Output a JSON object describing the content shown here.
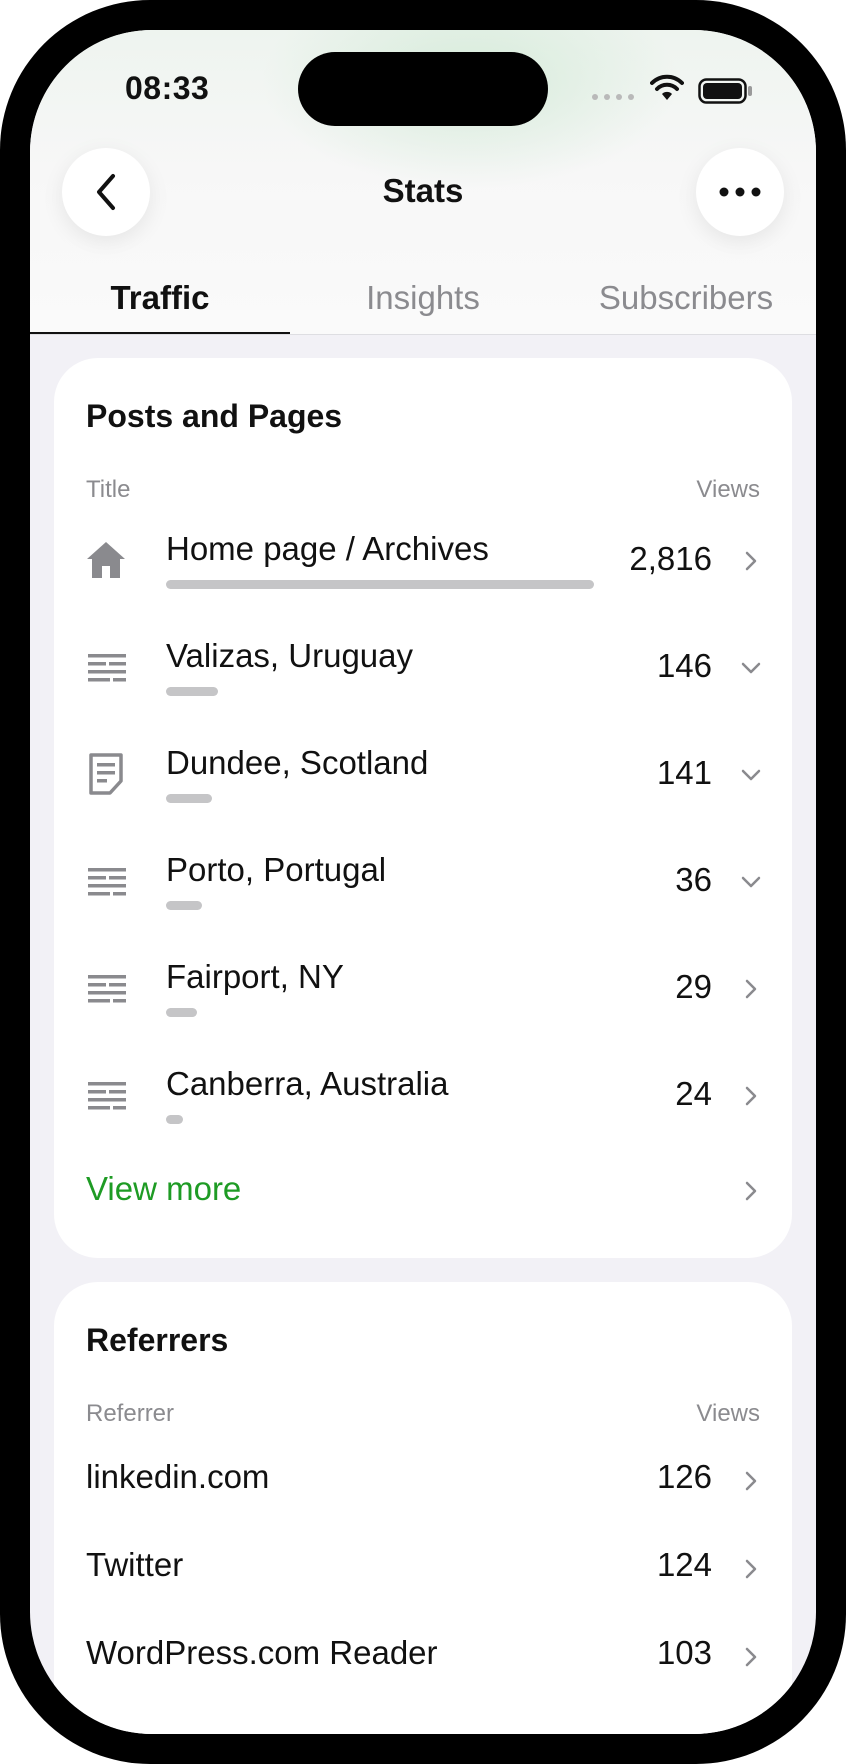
{
  "status_bar": {
    "time": "08:33"
  },
  "nav": {
    "title": "Stats",
    "back_icon": "chevron-left-icon",
    "more_icon": "ellipsis-icon"
  },
  "tabs": [
    {
      "label": "Traffic",
      "active": true
    },
    {
      "label": "Insights",
      "active": false
    },
    {
      "label": "Subscribers",
      "active": false
    }
  ],
  "posts_card": {
    "title": "Posts and Pages",
    "col_title": "Title",
    "col_views": "Views",
    "rows": [
      {
        "icon": "home-icon",
        "title": "Home page / Archives",
        "views": "2,816",
        "chevron": "chevron-right-icon",
        "bar_fraction": 1.0
      },
      {
        "icon": "text-lines-icon",
        "title": "Valizas, Uruguay",
        "views": "146",
        "chevron": "chevron-down-icon",
        "bar_fraction": 0.12
      },
      {
        "icon": "page-icon",
        "title": "Dundee, Scotland",
        "views": "141",
        "chevron": "chevron-down-icon",
        "bar_fraction": 0.105
      },
      {
        "icon": "text-lines-icon",
        "title": "Porto, Portugal",
        "views": "36",
        "chevron": "chevron-down-icon",
        "bar_fraction": 0.085
      },
      {
        "icon": "text-lines-icon",
        "title": "Fairport, NY",
        "views": "29",
        "chevron": "chevron-right-icon",
        "bar_fraction": 0.072
      },
      {
        "icon": "text-lines-icon",
        "title": "Canberra, Australia",
        "views": "24",
        "chevron": "chevron-right-icon",
        "bar_fraction": 0.04
      }
    ],
    "view_more": "View more"
  },
  "referrers_card": {
    "title": "Referrers",
    "col_referrer": "Referrer",
    "col_views": "Views",
    "rows": [
      {
        "name": "linkedin.com",
        "views": "126"
      },
      {
        "name": "Twitter",
        "views": "124"
      },
      {
        "name": "WordPress.com Reader",
        "views": "103"
      }
    ]
  },
  "colors": {
    "accent_green": "#1e9b24",
    "bar_gray": "#c5c5c7",
    "page_bg": "#f2f1f6"
  }
}
